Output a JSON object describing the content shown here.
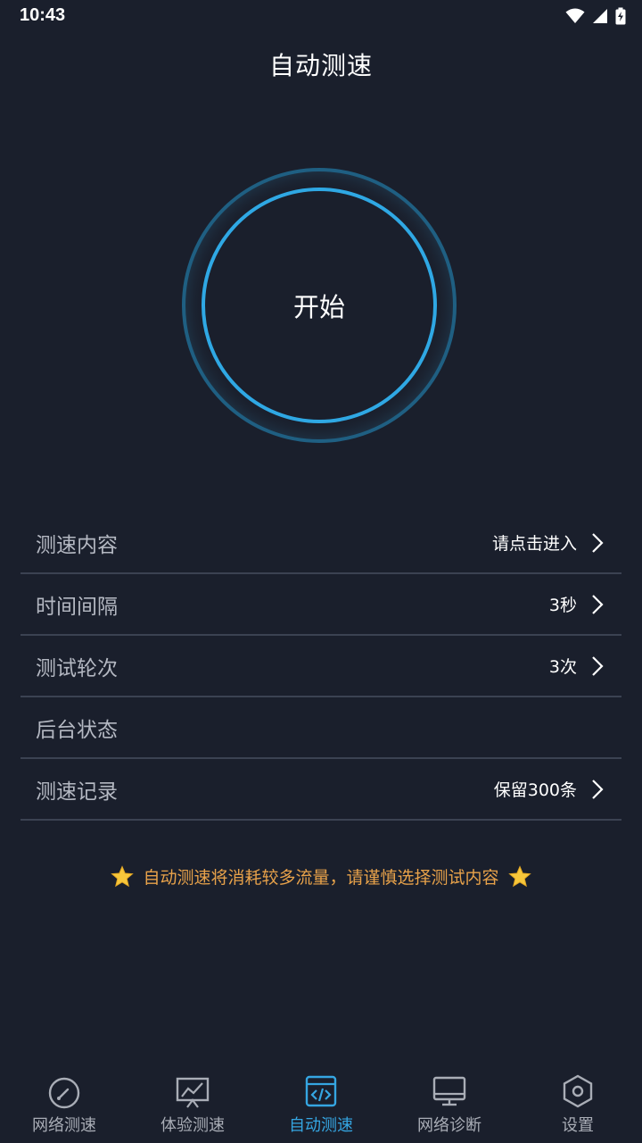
{
  "status_bar": {
    "time": "10:43"
  },
  "app_bar": {
    "title": "自动测速"
  },
  "start_button": {
    "label": "开始"
  },
  "settings": [
    {
      "label": "测速内容",
      "value": "请点击进入",
      "has_chevron": true
    },
    {
      "label": "时间间隔",
      "value": "3秒",
      "has_chevron": true
    },
    {
      "label": "测试轮次",
      "value": "3次",
      "has_chevron": true
    },
    {
      "label": "后台状态",
      "value": "",
      "has_chevron": false
    },
    {
      "label": "测速记录",
      "value": "保留300条",
      "has_chevron": true
    }
  ],
  "tip": {
    "text": "自动测速将消耗较多流量，请谨慎选择测试内容",
    "icon": "star-icon"
  },
  "bottom_nav": [
    {
      "label": "网络测速",
      "icon": "speedometer-icon",
      "active": false
    },
    {
      "label": "体验测速",
      "icon": "chart-monitor-icon",
      "active": false
    },
    {
      "label": "自动测速",
      "icon": "code-window-icon",
      "active": true
    },
    {
      "label": "网络诊断",
      "icon": "desktop-icon",
      "active": false
    },
    {
      "label": "设置",
      "icon": "settings-hexagon-icon",
      "active": false
    }
  ],
  "colors": {
    "background": "#1a1f2c",
    "accent": "#35a6e2",
    "tip": "#e8a24a",
    "divider": "#3b4252",
    "label_muted": "#b4b8c2"
  }
}
